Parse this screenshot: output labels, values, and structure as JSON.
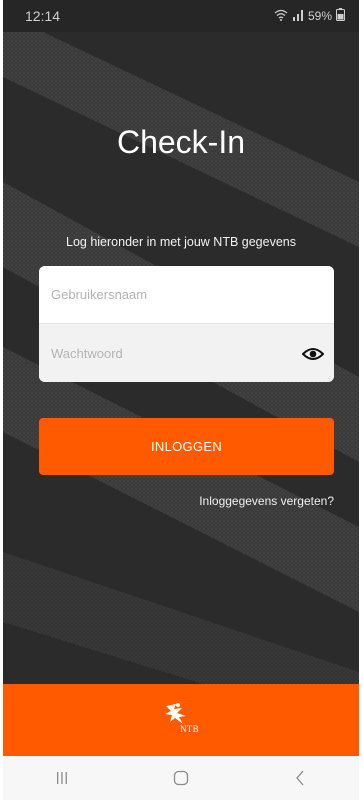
{
  "status_bar": {
    "time": "12:14",
    "battery": "59%",
    "icons": [
      "wifi-icon",
      "signal-icon",
      "battery-icon"
    ]
  },
  "title": "Check-In",
  "subtitle": "Log hieronder in met jouw NTB gegevens",
  "form": {
    "username": {
      "placeholder": "Gebruikersnaam",
      "value": ""
    },
    "password": {
      "placeholder": "Wachtwoord",
      "value": ""
    },
    "show_password_icon": "eye-icon"
  },
  "login_button": {
    "label": "INLOGGEN"
  },
  "forgot_link": "Inloggegevens vergeten?",
  "footer": {
    "logo_text": "NTB"
  },
  "nav_bar": {
    "icons": [
      "recent-apps-icon",
      "home-icon",
      "back-icon"
    ]
  },
  "colors": {
    "background": "#2b2b2b",
    "accent": "#ff5a00",
    "card": "#ffffff",
    "nav_bar": "#f7f7f7"
  }
}
